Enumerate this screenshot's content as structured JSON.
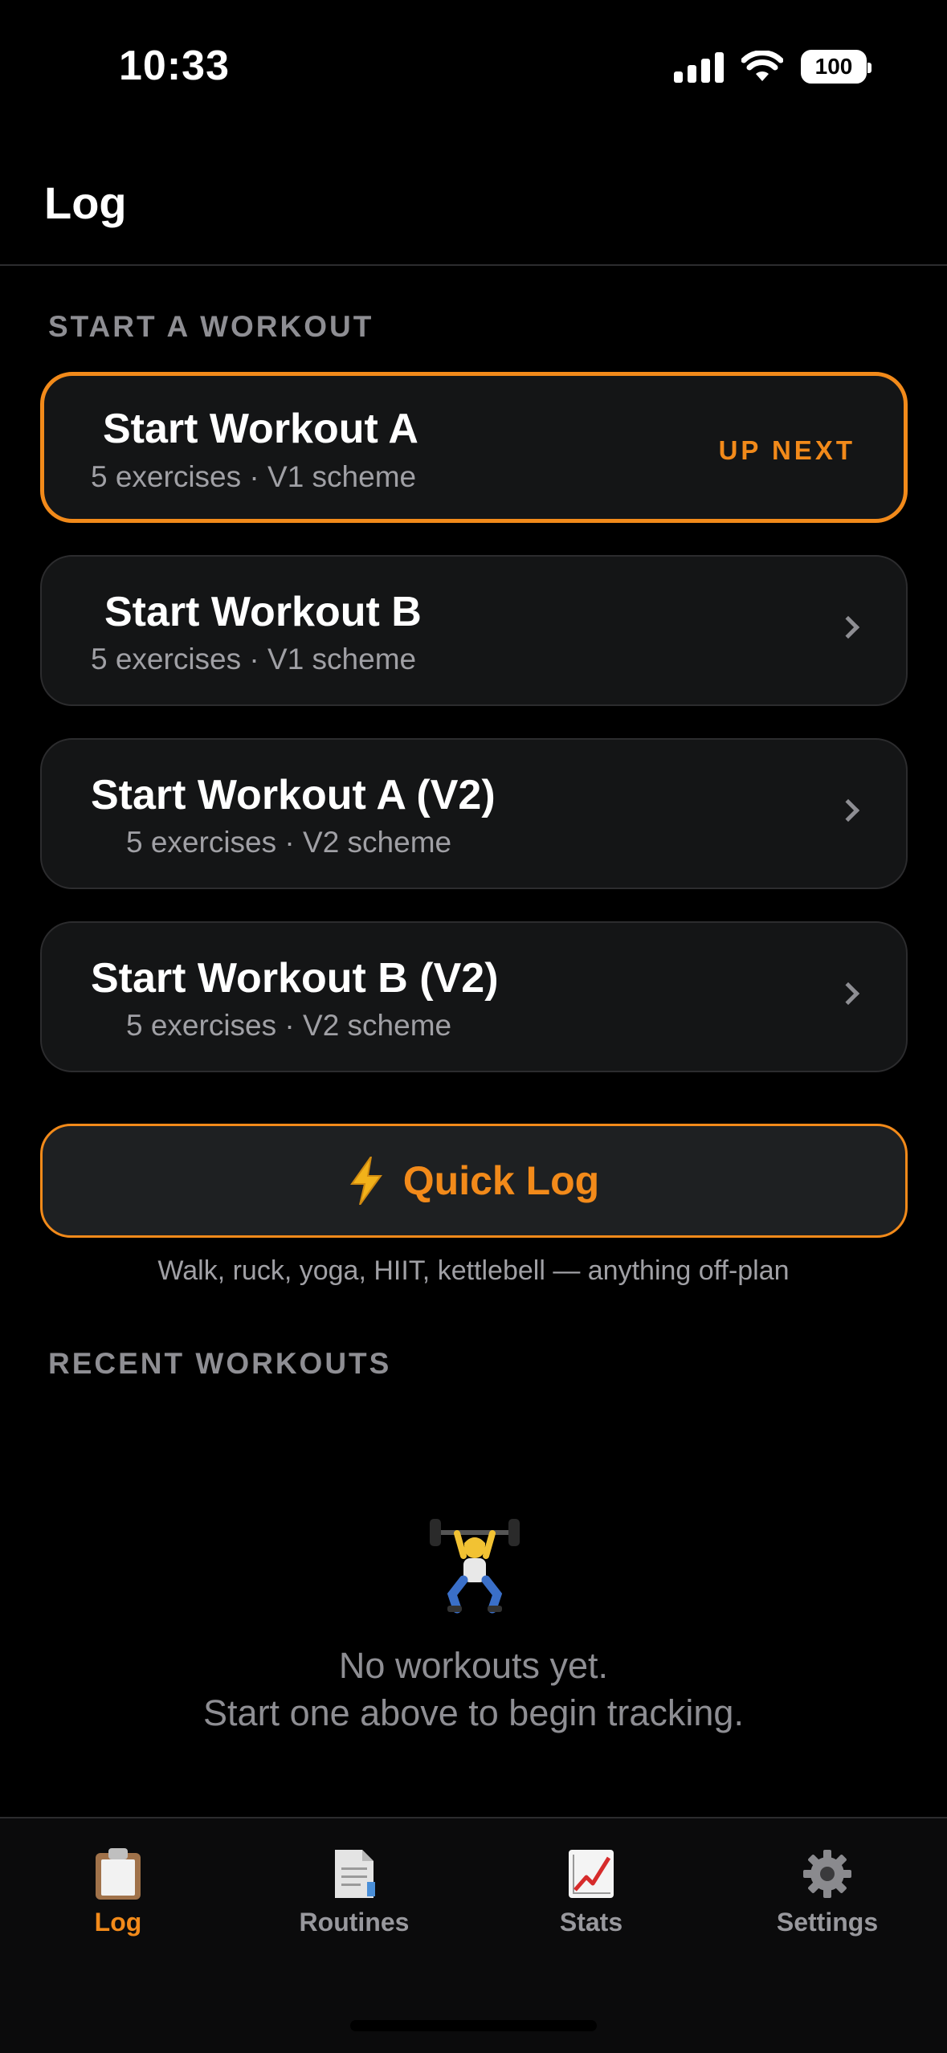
{
  "status_bar": {
    "time": "10:33",
    "battery": "100"
  },
  "header": {
    "title": "Log"
  },
  "sections": {
    "start": "START A WORKOUT",
    "recent": "RECENT WORKOUTS"
  },
  "workouts": [
    {
      "title": "Start Workout A",
      "subtitle": "5 exercises · V1 scheme",
      "badge": "UP NEXT"
    },
    {
      "title": "Start Workout B",
      "subtitle": "5 exercises · V1 scheme"
    },
    {
      "title": "Start Workout A (V2)",
      "subtitle": "5 exercises · V2 scheme"
    },
    {
      "title": "Start Workout B (V2)",
      "subtitle": "5 exercises · V2 scheme"
    }
  ],
  "quick_log": {
    "icon": "lightning-bolt",
    "label": "Quick Log",
    "hint": "Walk, ruck, yoga, HIIT, kettlebell — anything off-plan"
  },
  "empty_state": {
    "icon": "weightlifter",
    "line1": "No workouts yet.",
    "line2": "Start one above to begin tracking."
  },
  "tabs": [
    {
      "label": "Log",
      "icon": "clipboard-icon",
      "active": true
    },
    {
      "label": "Routines",
      "icon": "document-icon",
      "active": false
    },
    {
      "label": "Stats",
      "icon": "chart-icon",
      "active": false
    },
    {
      "label": "Settings",
      "icon": "gear-icon",
      "active": false
    }
  ],
  "colors": {
    "accent": "#f28a1a",
    "background": "#000000",
    "card": "#141516",
    "secondary_text": "#a0a0a5"
  }
}
